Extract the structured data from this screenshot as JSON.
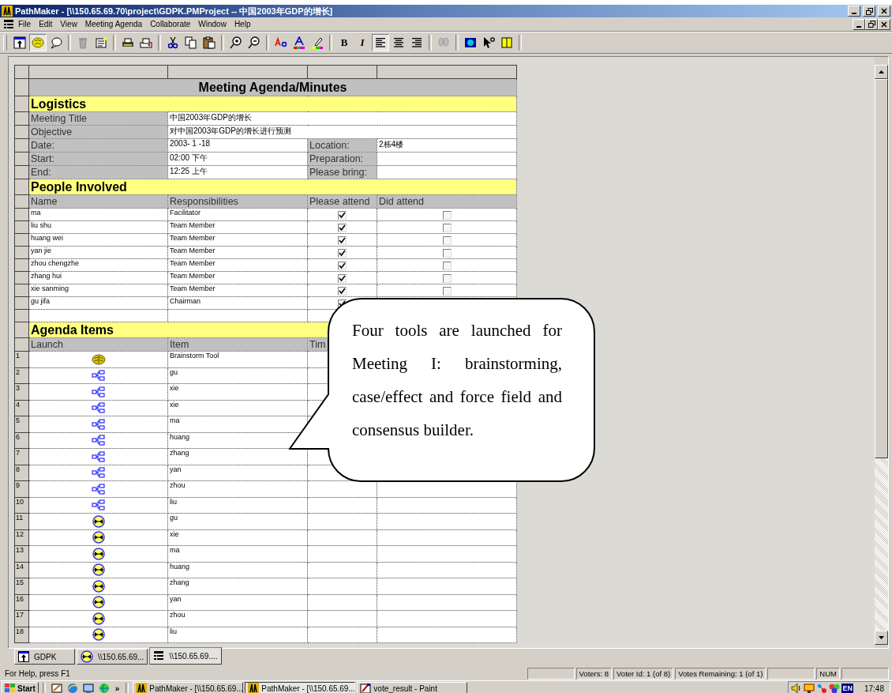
{
  "window": {
    "title": "PathMaker - [\\\\150.65.69.70\\project\\GDPK.PMProject -- 中国2003年GDP的增长]"
  },
  "menu": [
    "File",
    "Edit",
    "View",
    "Meeting Agenda",
    "Collaborate",
    "Window",
    "Help"
  ],
  "format_buttons": [
    {
      "label": "B",
      "kind": "bold",
      "selected": false
    },
    {
      "label": "I",
      "kind": "italic",
      "selected": false
    }
  ],
  "align_buttons": [
    {
      "kind": "left",
      "selected": true
    },
    {
      "kind": "center",
      "selected": false
    },
    {
      "kind": "right",
      "selected": false
    }
  ],
  "sheet": {
    "title": "Meeting Agenda/Minutes",
    "logistics_heading": "Logistics",
    "logistics": [
      {
        "label": "Meeting Title",
        "value": "中国2003年GDP的增长"
      },
      {
        "label": "Objective",
        "value": "对中国2003年GDP的增长进行预测"
      },
      {
        "label": "Date:",
        "value": "2003- 1 -18",
        "label2": "Location:",
        "value2": "2栋4楼"
      },
      {
        "label": "Start:",
        "value": "02:00 下午",
        "label2": "Preparation:"
      },
      {
        "label": "End:",
        "value": "12:25 上午",
        "label2": "Please bring:"
      }
    ],
    "people_heading": "People Involved",
    "people_columns": [
      "Name",
      "Responsibilities",
      "Please attend",
      "Did attend"
    ],
    "people": [
      {
        "name": "ma",
        "role": "Facilitator",
        "please_attend": true,
        "did_attend": false
      },
      {
        "name": "liu shu",
        "role": "Team Member",
        "please_attend": true,
        "did_attend": false
      },
      {
        "name": "huang wei",
        "role": "Team Member",
        "please_attend": true,
        "did_attend": false
      },
      {
        "name": "yan jie",
        "role": "Team Member",
        "please_attend": true,
        "did_attend": false
      },
      {
        "name": "zhou chengzhe",
        "role": "Team Member",
        "please_attend": true,
        "did_attend": false
      },
      {
        "name": "zhang hui",
        "role": "Team Member",
        "please_attend": true,
        "did_attend": false
      },
      {
        "name": "xie sanming",
        "role": "Team Member",
        "please_attend": true,
        "did_attend": false
      },
      {
        "name": "gu jifa",
        "role": "Chairman",
        "please_attend": true
      }
    ],
    "agenda_heading": "Agenda Items",
    "agenda_columns": [
      "Launch",
      "Item",
      "Tim"
    ],
    "agenda": [
      {
        "number": "1",
        "kind": "brainstorm",
        "item": "Brainstorm Tool"
      },
      {
        "number": "2",
        "kind": "diagram",
        "item": "gu"
      },
      {
        "number": "3",
        "kind": "diagram",
        "item": "xie"
      },
      {
        "number": "4",
        "kind": "diagram",
        "item": "xie"
      },
      {
        "number": "5",
        "kind": "diagram",
        "item": "ma"
      },
      {
        "number": "6",
        "kind": "diagram",
        "item": "huang"
      },
      {
        "number": "7",
        "kind": "diagram",
        "item": "zhang"
      },
      {
        "number": "8",
        "kind": "diagram",
        "item": "yan"
      },
      {
        "number": "9",
        "kind": "diagram",
        "item": "zhou"
      },
      {
        "number": "10",
        "kind": "diagram",
        "item": "liu"
      },
      {
        "number": "11",
        "kind": "force",
        "item": "gu"
      },
      {
        "number": "12",
        "kind": "force",
        "item": "xie"
      },
      {
        "number": "13",
        "kind": "force",
        "item": "ma"
      },
      {
        "number": "14",
        "kind": "force",
        "item": "huang"
      },
      {
        "number": "15",
        "kind": "force",
        "item": "zhang"
      },
      {
        "number": "16",
        "kind": "force",
        "item": "yan"
      },
      {
        "number": "17",
        "kind": "force",
        "item": "zhou"
      },
      {
        "number": "18",
        "kind": "force",
        "item": "liu"
      }
    ]
  },
  "callout": {
    "text": "Four tools are launched for Meeting I: brainstorming, case/effect and force field and consensus builder."
  },
  "doc_tabs": [
    {
      "label": "GDPK",
      "kind": "project",
      "selected": false
    },
    {
      "label": "\\\\150.65.69...",
      "kind": "force",
      "selected": false
    },
    {
      "label": "\\\\150.65.69....",
      "kind": "agenda",
      "selected": true
    }
  ],
  "status_bar": {
    "help": "For Help, press F1",
    "panels": [
      {
        "kind": "blank"
      },
      {
        "kind": "text",
        "text": "Voters: 8"
      },
      {
        "kind": "text",
        "text": "Voter Id: 1 (of 8)"
      },
      {
        "kind": "text",
        "text": "Votes Remaining: 1 (of 1)"
      },
      {
        "kind": "blank"
      },
      {
        "kind": "text",
        "text": "NUM"
      },
      {
        "kind": "blank"
      }
    ]
  },
  "taskbar": {
    "start": "Start",
    "more": "»",
    "tasks": [
      {
        "label": "PathMaker - [\\\\150.65.69...",
        "kind": "pathmaker",
        "selected": false
      },
      {
        "label": "PathMaker - [\\\\150.65.69...",
        "kind": "pathmaker",
        "selected": true
      },
      {
        "label": "vote_result - Paint",
        "kind": "paint",
        "selected": false
      }
    ],
    "language": "EN",
    "clock": "17:48"
  }
}
